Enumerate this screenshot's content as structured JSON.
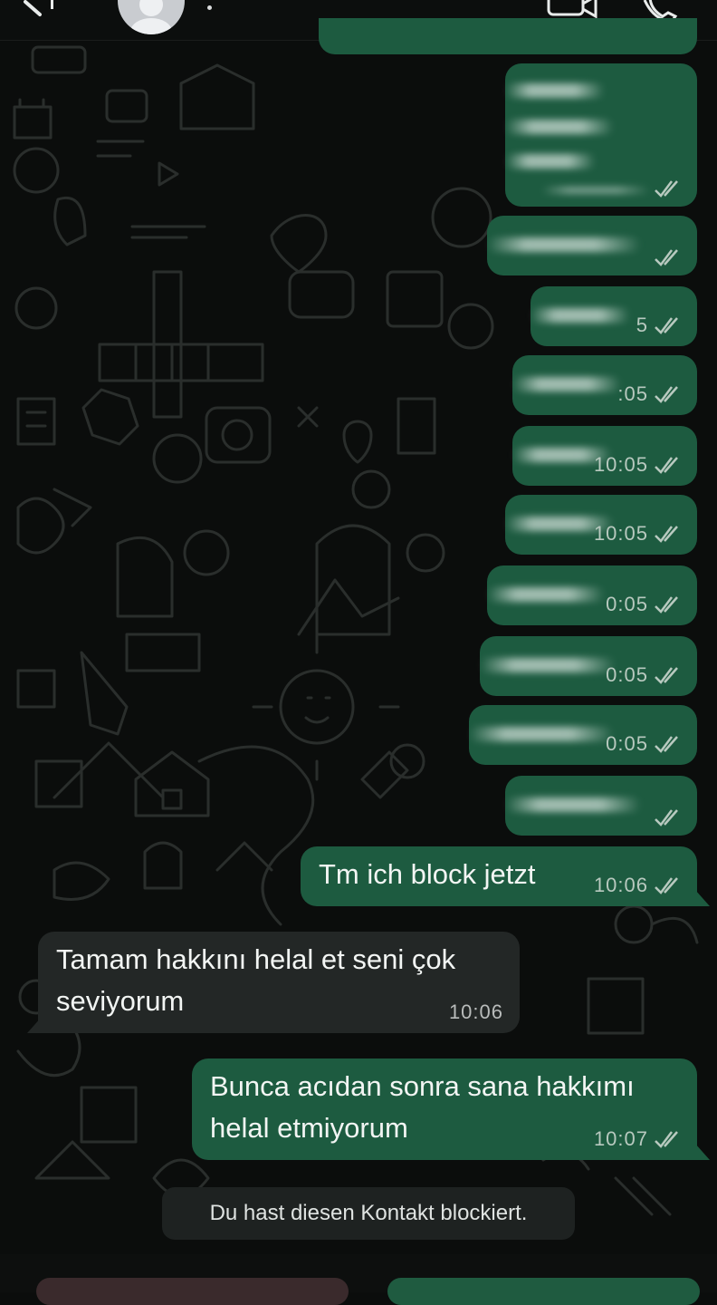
{
  "header": {
    "back_icon": "back-arrow-icon",
    "video_icon": "video-call-icon",
    "phone_icon": "phone-call-icon"
  },
  "messages": [
    {
      "direction": "outgoing",
      "time": "",
      "redacted": true
    },
    {
      "direction": "outgoing",
      "time": "",
      "redacted": true
    },
    {
      "direction": "outgoing",
      "time": "",
      "redacted": true
    },
    {
      "direction": "outgoing",
      "time": "5",
      "redacted": true
    },
    {
      "direction": "outgoing",
      "time": ":05",
      "redacted": true
    },
    {
      "direction": "outgoing",
      "time": "10:05",
      "redacted": true
    },
    {
      "direction": "outgoing",
      "time": "10:05",
      "redacted": true
    },
    {
      "direction": "outgoing",
      "time": "0:05",
      "redacted": true
    },
    {
      "direction": "outgoing",
      "time": "0:05",
      "redacted": true
    },
    {
      "direction": "outgoing",
      "time": "0:05",
      "redacted": true
    },
    {
      "direction": "outgoing",
      "time": "",
      "redacted": true
    },
    {
      "direction": "outgoing",
      "text": "Tm ich block jetzt",
      "time": "10:06"
    },
    {
      "direction": "incoming",
      "text_line1": "Tamam hakkını helal et seni çok",
      "text_line2": "seviyorum",
      "time": "10:06"
    },
    {
      "direction": "outgoing",
      "text_line1": "Bunca acıdan sonra sana hakkımı",
      "text_line2": "helal etmiyorum",
      "time": "10:07"
    }
  ],
  "system_notice": "Du hast diesen Kontakt blockiert.",
  "colors": {
    "outgoing_bubble": "#1d5b40",
    "incoming_bubble": "#232726",
    "background": "#0b0d0c",
    "tick_color": "#b8c9bf"
  }
}
